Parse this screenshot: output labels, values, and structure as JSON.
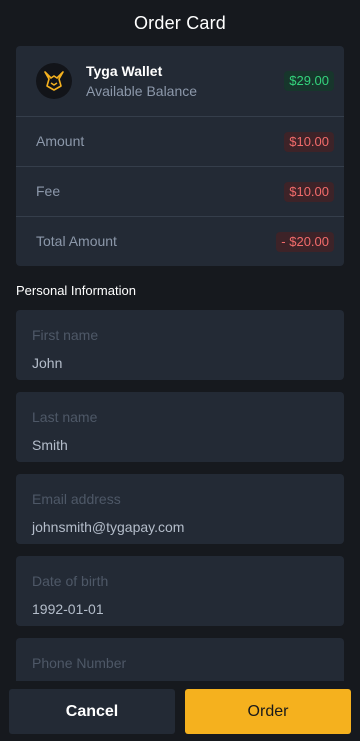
{
  "header": {
    "title": "Order Card"
  },
  "wallet": {
    "name": "Tyga Wallet",
    "subtitle": "Available Balance",
    "balance": "$29.00",
    "logo_icon": "tyga-fox-logo-icon"
  },
  "summary": [
    {
      "label": "Amount",
      "value": "$10.00"
    },
    {
      "label": "Fee",
      "value": "$10.00"
    },
    {
      "label": "Total Amount",
      "value": "- $20.00"
    }
  ],
  "personal": {
    "title": "Personal Information",
    "fields": [
      {
        "label": "First name",
        "value": "John"
      },
      {
        "label": "Last name",
        "value": "Smith"
      },
      {
        "label": "Email address",
        "value": "johnsmith@tygapay.com"
      },
      {
        "label": "Date of birth",
        "value": "1992-01-01"
      },
      {
        "label": "Phone Number",
        "value": ""
      }
    ]
  },
  "actions": {
    "cancel": "Cancel",
    "order": "Order"
  },
  "colors": {
    "accent": "#f5b11e",
    "positive": "#34d37c",
    "negative": "#f26b6b",
    "card": "#232a35",
    "background": "#16191e"
  }
}
